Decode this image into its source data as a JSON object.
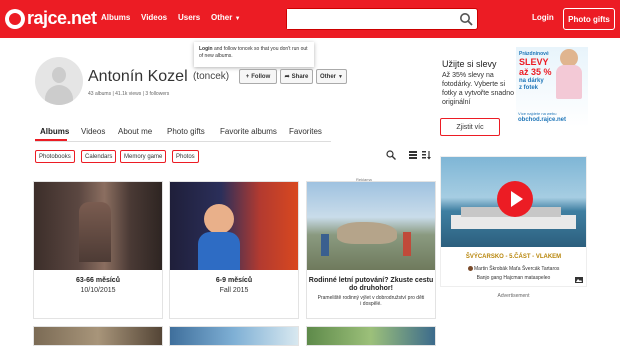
{
  "header": {
    "logo_text": "rajce.net",
    "nav": [
      "Albums",
      "Videos",
      "Users",
      "Other"
    ],
    "search_placeholder": "",
    "login": "Login",
    "photo_gifts": "Photo gifts"
  },
  "tooltip": {
    "login_word": "Login",
    "rest": " and follow toncek so that you don't run out of new albums."
  },
  "profile": {
    "name": "Antonín Kozel",
    "login": "(toncek)",
    "albums": "43 albums",
    "views": "41.1k views",
    "followers": "3 followers",
    "follow": "Follow",
    "share": "Share",
    "other": "Other"
  },
  "tabs": [
    "Albums",
    "Videos",
    "About me",
    "Photo gifts",
    "Favorite albums",
    "Favorites"
  ],
  "filters": [
    "Photobooks",
    "Calendars",
    "Memory game",
    "Photos"
  ],
  "albums": [
    {
      "title": "63-66 měsíců",
      "sub": "10/10/2015"
    },
    {
      "title": "6-9 měsíců",
      "sub": "Fall 2015"
    }
  ],
  "ad_card": {
    "label": "Reklama",
    "title": "Rodinné letní putování? Zkuste cestu do druhohor!",
    "text": "Prameliště rodinný výlet v dobrodružství pro děti i dospělé."
  },
  "promo": {
    "title": "Užijte si slevy",
    "text": "Až 35% slevy na fotodárky. Vyberte si fotky a vytvořte snadno originální",
    "button": "Zjistit víc",
    "img_line1": "Prázdninové",
    "img_line2": "SLEVY",
    "img_line3": "až 35 %",
    "img_line4": "na dárky",
    "img_line5": "z fotek",
    "img_line6": "Více najdete na webu",
    "img_line7": "obchod.rajce.net"
  },
  "video_ad": {
    "title": "ŠVÝCARSKO - 5.ČÁST - VLAKEM",
    "authors": "Martin Škrobák Maťa Švercák Tartaros",
    "subtitle": "Banjo gang Hajcman mataspeleo"
  },
  "ad_note": "Advertisement",
  "colors": {
    "brand": "#ec1c24"
  }
}
